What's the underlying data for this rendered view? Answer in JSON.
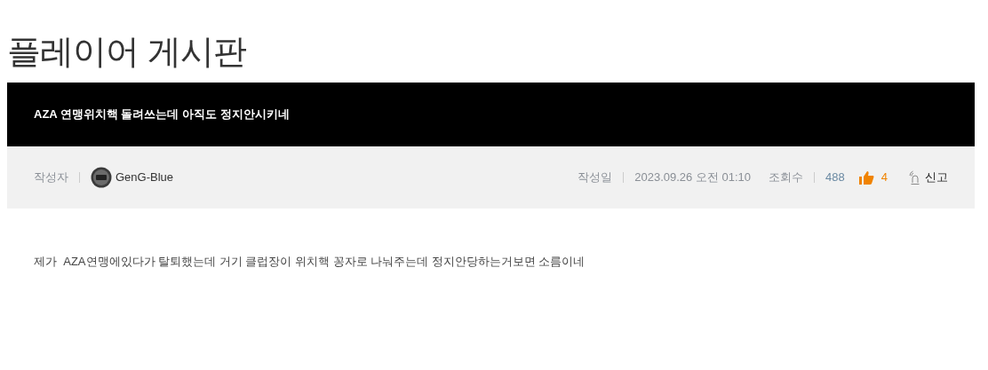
{
  "board_title": "플레이어 게시판",
  "post": {
    "title": "AZA 연맹위치핵 돌려쓰는데 아직도 정지안시키네",
    "author_label": "작성자",
    "author": "GenG-Blue",
    "date_label": "작성일",
    "date": "2023.09.26 오전 01:10",
    "views_label": "조회수",
    "views": "488",
    "likes": "4",
    "report": "신고",
    "body": "제가  AZA연맹에있다가 탈퇴했는데 거기 클럽장이 위치핵 꽁자로 나눠주는데 정지안당하는거보면 소름이네"
  }
}
